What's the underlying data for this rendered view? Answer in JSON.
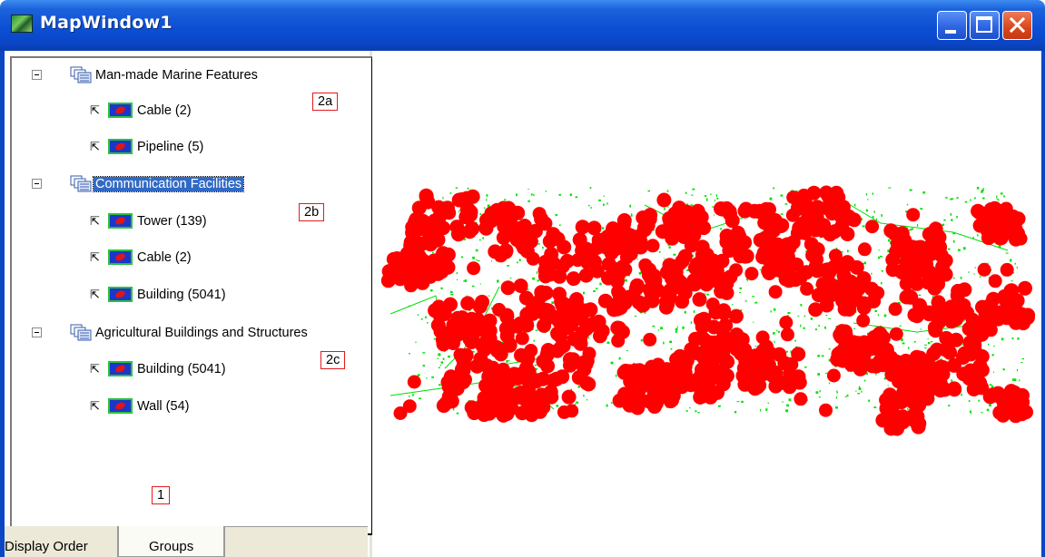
{
  "window": {
    "title": "MapWindow1",
    "icon": "mapwindow-app-icon",
    "controls": [
      "minimize-icon",
      "maximize-icon",
      "close-icon"
    ]
  },
  "legend": {
    "groups": [
      {
        "label": "Man-made Marine Features",
        "selected": false,
        "annotation": "2a",
        "layers": [
          {
            "label": "Cable (2)"
          },
          {
            "label": "Pipeline (5)"
          }
        ]
      },
      {
        "label": "Communication Facilities",
        "selected": true,
        "annotation": "2b",
        "layers": [
          {
            "label": "Tower (139)"
          },
          {
            "label": "Cable (2)"
          },
          {
            "label": "Building (5041)"
          }
        ]
      },
      {
        "label": "Agricultural Buildings and Structures",
        "selected": false,
        "annotation": "2c",
        "layers": [
          {
            "label": "Building (5041)"
          },
          {
            "label": "Wall (54)"
          }
        ]
      }
    ],
    "panel_annotation": "1"
  },
  "tabs": [
    {
      "label": "Display Order",
      "active": false
    },
    {
      "label": "Groups",
      "active": true
    }
  ],
  "colors": {
    "titlebar": "#0c4fd4",
    "selection": "#316ac5",
    "point_symbol": "#ff0000",
    "line_symbol": "#00e000",
    "annotation_border": "#e21b1b"
  }
}
